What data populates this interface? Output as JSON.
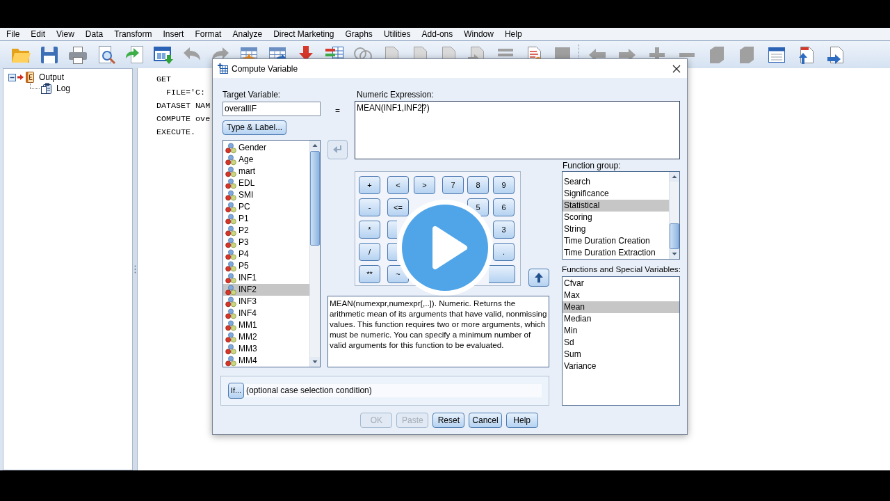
{
  "menu_bar": [
    "File",
    "Edit",
    "View",
    "Data",
    "Transform",
    "Insert",
    "Format",
    "Analyze",
    "Direct Marketing",
    "Graphs",
    "Utilities",
    "Add-ons",
    "Window",
    "Help"
  ],
  "toolbar_groups": [
    [
      {
        "kind": "folder",
        "disabled": false
      },
      {
        "kind": "floppy",
        "disabled": false
      },
      {
        "kind": "printer",
        "disabled": false
      },
      {
        "kind": "preview",
        "disabled": false
      },
      {
        "kind": "export",
        "disabled": false
      },
      {
        "kind": "recall",
        "disabled": false
      },
      {
        "kind": "undo",
        "disabled": true
      },
      {
        "kind": "redo",
        "disabled": true
      },
      {
        "kind": "gridstar",
        "disabled": false
      },
      {
        "kind": "gridarrow",
        "disabled": false
      },
      {
        "kind": "downarrow",
        "disabled": false
      },
      {
        "kind": "gridbars",
        "disabled": false
      },
      {
        "kind": "circles",
        "disabled": true
      },
      {
        "kind": "document",
        "disabled": true
      },
      {
        "kind": "document",
        "disabled": true
      },
      {
        "kind": "document",
        "disabled": true
      },
      {
        "kind": "docarrow",
        "disabled": true
      },
      {
        "kind": "lines",
        "disabled": true
      },
      {
        "kind": "docchart",
        "disabled": false
      },
      {
        "kind": "square",
        "disabled": true
      }
    ],
    [
      {
        "kind": "left",
        "disabled": true
      },
      {
        "kind": "right",
        "disabled": true
      },
      {
        "kind": "plus",
        "disabled": true
      },
      {
        "kind": "minus",
        "disabled": true
      },
      {
        "kind": "cube",
        "disabled": true
      },
      {
        "kind": "cube",
        "disabled": true
      },
      {
        "kind": "window",
        "disabled": false
      },
      {
        "kind": "pageup",
        "disabled": false
      },
      {
        "kind": "pagearrow",
        "disabled": false
      }
    ]
  ],
  "outline": [
    {
      "label": "Output",
      "kind": "output",
      "expanded": true,
      "current": true,
      "children": [
        {
          "label": "Log",
          "kind": "log",
          "current": false
        }
      ]
    }
  ],
  "syntax_lines": [
    {
      "kind": "command",
      "text": "GET"
    },
    {
      "kind": "subcommand",
      "text": "FILE='C:"
    },
    {
      "kind": "command",
      "text": "DATASET NAM"
    },
    {
      "kind": "command",
      "text": "COMPUTE ove"
    },
    {
      "kind": "command",
      "text": "EXECUTE."
    }
  ],
  "dialog": {
    "title": "Compute Variable",
    "target_label": "Target Variable:",
    "target_value": "overallIF",
    "equals": "=",
    "type_label_button": "Type & Label...",
    "variables": [
      {
        "label": "Gender",
        "selected": false
      },
      {
        "label": "Age",
        "selected": false
      },
      {
        "label": "mart",
        "selected": false
      },
      {
        "label": "EDL",
        "selected": false
      },
      {
        "label": "SMI",
        "selected": false
      },
      {
        "label": "PC",
        "selected": false
      },
      {
        "label": "P1",
        "selected": false
      },
      {
        "label": "P2",
        "selected": false
      },
      {
        "label": "P3",
        "selected": false
      },
      {
        "label": "P4",
        "selected": false
      },
      {
        "label": "P5",
        "selected": false
      },
      {
        "label": "INF1",
        "selected": false
      },
      {
        "label": "INF2",
        "selected": true
      },
      {
        "label": "INF3",
        "selected": false
      },
      {
        "label": "INF4",
        "selected": false
      },
      {
        "label": "MM1",
        "selected": false
      },
      {
        "label": "MM2",
        "selected": false
      },
      {
        "label": "MM3",
        "selected": false
      },
      {
        "label": "MM4",
        "selected": false
      }
    ],
    "move_button": {
      "disabled": true
    },
    "expression_label": "Numeric Expression:",
    "expression": {
      "text_before_cursor": "MEAN(INF1,INF2",
      "text_after_cursor": "?)"
    },
    "keypad": [
      [
        {
          "kind": "key",
          "label": "+"
        },
        {
          "kind": "key",
          "label": "<"
        },
        {
          "kind": "key",
          "label": ">"
        },
        {
          "kind": "key",
          "label": "7"
        },
        {
          "kind": "key",
          "label": "8"
        },
        {
          "kind": "key",
          "label": "9"
        }
      ],
      [
        {
          "kind": "key",
          "label": "-"
        },
        {
          "kind": "key",
          "label": "<="
        },
        {
          "kind": "covered"
        },
        {
          "kind": "covered"
        },
        {
          "kind": "key",
          "label": "5"
        },
        {
          "kind": "key",
          "label": "6"
        }
      ],
      [
        {
          "kind": "key",
          "label": "*"
        },
        {
          "kind": "partial"
        },
        {
          "kind": "covered"
        },
        {
          "kind": "covered"
        },
        {
          "kind": "covered"
        },
        {
          "kind": "key",
          "label": "3"
        }
      ],
      [
        {
          "kind": "key",
          "label": "/"
        },
        {
          "kind": "partial"
        },
        {
          "kind": "covered"
        },
        {
          "kind": "covered"
        },
        {
          "kind": "covered"
        },
        {
          "kind": "key",
          "label": "."
        }
      ],
      [
        {
          "kind": "key",
          "label": "**"
        },
        {
          "kind": "key",
          "label": "~"
        },
        {
          "kind": "covered"
        },
        {
          "kind": "covered"
        },
        {
          "kind": "wide"
        }
      ]
    ],
    "insert_button": {
      "disabled": false
    },
    "description": "MEAN(numexpr,numexpr[,..]). Numeric. Returns the arithmetic mean of its arguments that have valid, nonmissing values. This function requires two or more arguments, which must be numeric. You can specify a minimum number of valid arguments for this function to be evaluated.",
    "function_group_label": "Function group:",
    "function_groups": [
      {
        "label": "Search",
        "selected": false
      },
      {
        "label": "Significance",
        "selected": false
      },
      {
        "label": "Statistical",
        "selected": true
      },
      {
        "label": "Scoring",
        "selected": false
      },
      {
        "label": "String",
        "selected": false
      },
      {
        "label": "Time Duration Creation",
        "selected": false
      },
      {
        "label": "Time Duration Extraction",
        "selected": false
      }
    ],
    "functions_label": "Functions and Special Variables:",
    "functions": [
      {
        "label": "Cfvar",
        "selected": false
      },
      {
        "label": "Max",
        "selected": false
      },
      {
        "label": "Mean",
        "selected": true
      },
      {
        "label": "Median",
        "selected": false
      },
      {
        "label": "Min",
        "selected": false
      },
      {
        "label": "Sd",
        "selected": false
      },
      {
        "label": "Sum",
        "selected": false
      },
      {
        "label": "Variance",
        "selected": false
      }
    ],
    "if_button": "If...",
    "if_condition": "(optional case selection condition)",
    "buttons": [
      {
        "label": "OK",
        "disabled": true
      },
      {
        "label": "Paste",
        "disabled": true
      },
      {
        "label": "Reset",
        "disabled": false
      },
      {
        "label": "Cancel",
        "disabled": false
      },
      {
        "label": "Help",
        "disabled": false
      }
    ]
  }
}
